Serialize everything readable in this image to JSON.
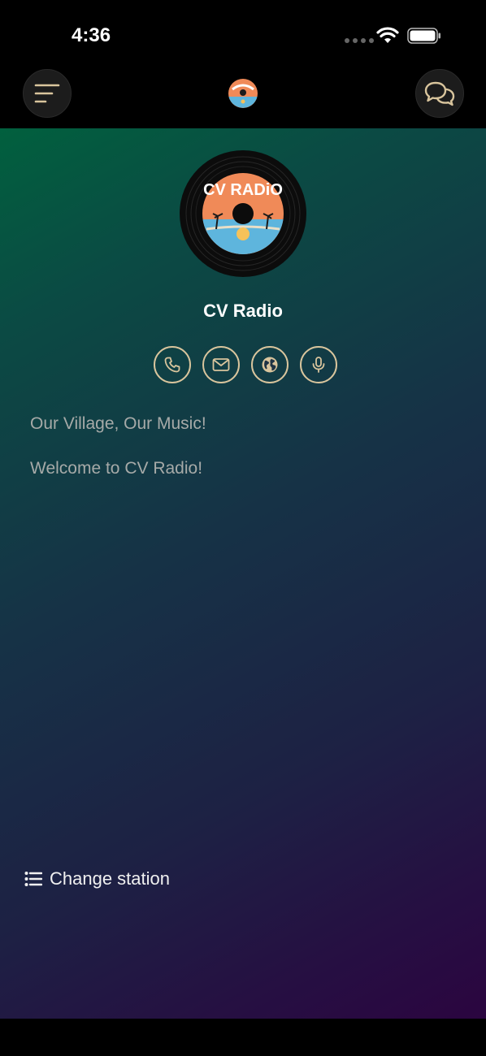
{
  "status_bar": {
    "time": "4:36"
  },
  "nav": {
    "menu_icon": "menu-icon",
    "logo_icon": "cv-radio-logo",
    "chat_icon": "chat-bubbles-icon"
  },
  "station": {
    "name": "CV Radio",
    "logo_text": "CV RADiO",
    "actions": [
      {
        "icon": "phone-icon"
      },
      {
        "icon": "mail-icon"
      },
      {
        "icon": "globe-icon"
      },
      {
        "icon": "microphone-icon"
      }
    ],
    "description_lines": [
      "Our Village, Our Music!",
      "Welcome to CV Radio!"
    ]
  },
  "footer": {
    "change_station_label": "Change station",
    "change_station_icon": "list-icon"
  },
  "colors": {
    "accent": "#d9c59d",
    "gradient_start": "#01603e",
    "gradient_end": "#2b0540",
    "text_muted": "#a6aaa8"
  }
}
